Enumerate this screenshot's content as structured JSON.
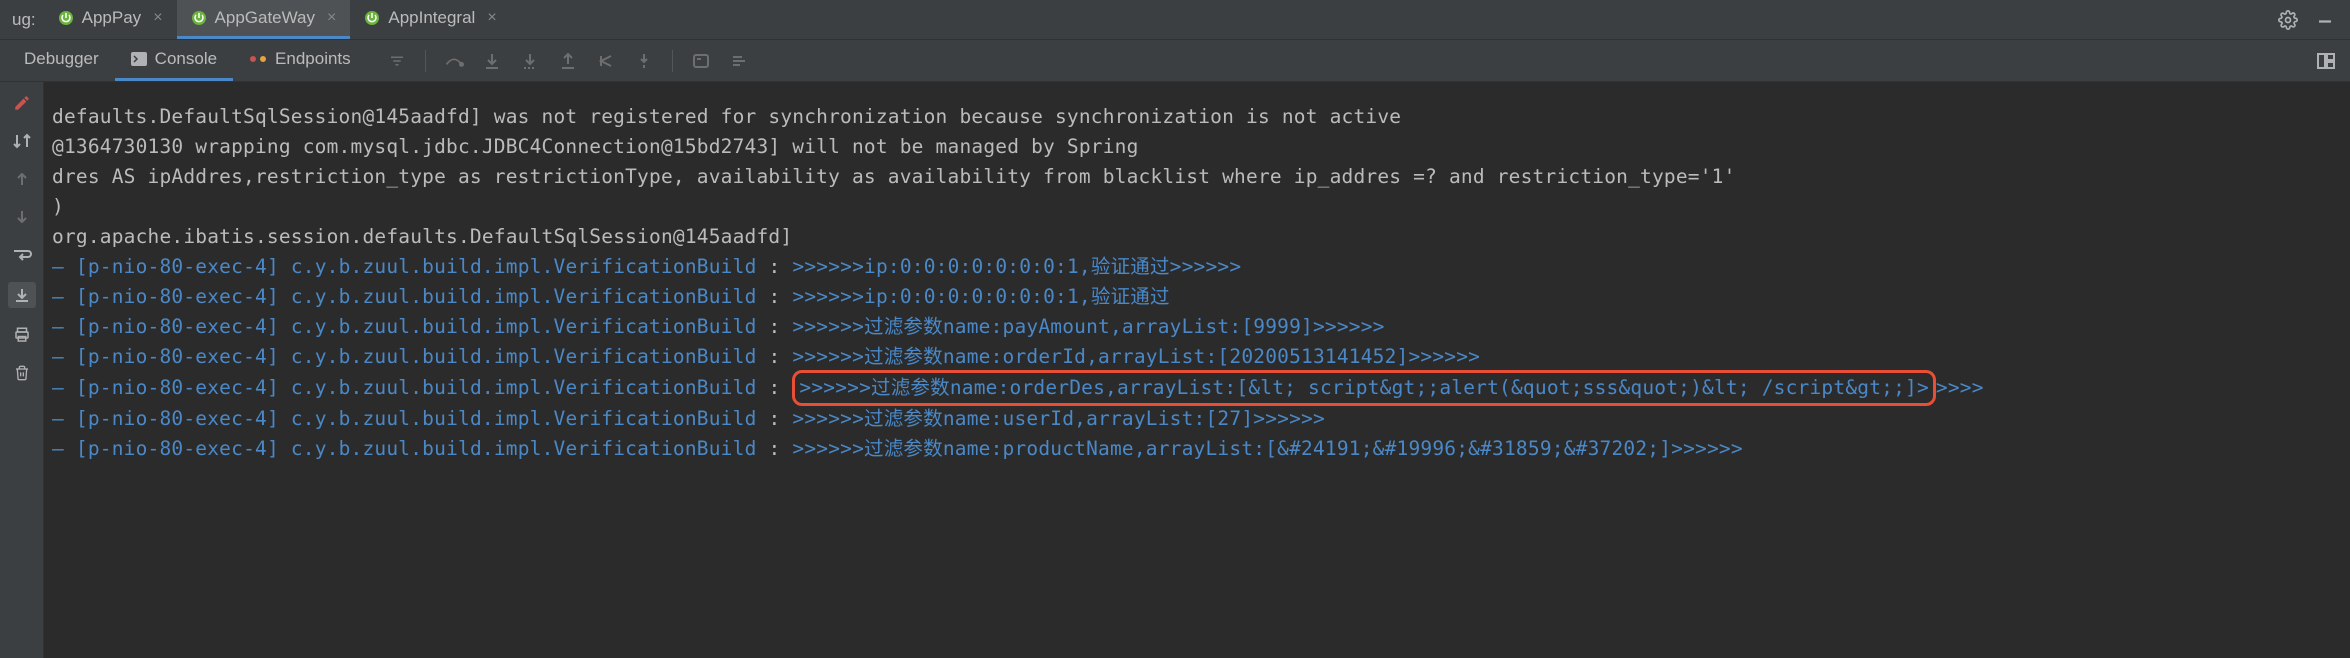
{
  "top": {
    "label": "ug:",
    "tabs": [
      {
        "name": "AppPay",
        "active": false
      },
      {
        "name": "AppGateWay",
        "active": true
      },
      {
        "name": "AppIntegral",
        "active": false
      }
    ]
  },
  "subtabs": [
    {
      "name": "Debugger",
      "active": false
    },
    {
      "name": "Console",
      "active": true
    },
    {
      "name": "Endpoints",
      "active": false
    }
  ],
  "console": {
    "plain_lines": [
      "defaults.DefaultSqlSession@145aadfd] was not registered for synchronization because synchronization is not active",
      "@1364730130 wrapping com.mysql.jdbc.JDBC4Connection@15bd2743] will not be managed by Spring",
      "dres AS ipAddres,restriction_type as restrictionType, availability as availability from blacklist where ip_addres =? and restriction_type='1'",
      ")",
      "",
      "org.apache.ibatis.session.defaults.DefaultSqlSession@145aadfd]"
    ],
    "log_lines": [
      {
        "thread": "[p-nio-80-exec-4]",
        "logger": "c.y.b.zuul.build.impl.VerificationBuild",
        "msg": ">>>>>>ip:0:0:0:0:0:0:0:1,验证通过>>>>>>",
        "highlighted": false
      },
      {
        "thread": "[p-nio-80-exec-4]",
        "logger": "c.y.b.zuul.build.impl.VerificationBuild",
        "msg": ">>>>>>ip:0:0:0:0:0:0:0:1,验证通过",
        "highlighted": false
      },
      {
        "thread": "[p-nio-80-exec-4]",
        "logger": "c.y.b.zuul.build.impl.VerificationBuild",
        "msg": ">>>>>>过滤参数name:payAmount,arrayList:[9999]>>>>>>",
        "highlighted": false
      },
      {
        "thread": "[p-nio-80-exec-4]",
        "logger": "c.y.b.zuul.build.impl.VerificationBuild",
        "msg": ">>>>>>过滤参数name:orderId,arrayList:[20200513141452]>>>>>>",
        "highlighted": false
      },
      {
        "thread": "[p-nio-80-exec-4]",
        "logger": "c.y.b.zuul.build.impl.VerificationBuild",
        "msg": ">>>>>>过滤参数name:orderDes,arrayList:[&lt; script&gt;;alert(&quot;sss&quot;)&lt; /script&gt;;]>",
        "tail": ">>>>",
        "highlighted": true
      },
      {
        "thread": "[p-nio-80-exec-4]",
        "logger": "c.y.b.zuul.build.impl.VerificationBuild",
        "msg": ">>>>>>过滤参数name:userId,arrayList:[27]>>>>>>",
        "highlighted": false
      },
      {
        "thread": "[p-nio-80-exec-4]",
        "logger": "c.y.b.zuul.build.impl.VerificationBuild",
        "msg": ">>>>>>过滤参数name:productName,arrayList:[&#24191;&#19996;&#31859;&#37202;]>>>>>>",
        "highlighted": false
      }
    ]
  }
}
